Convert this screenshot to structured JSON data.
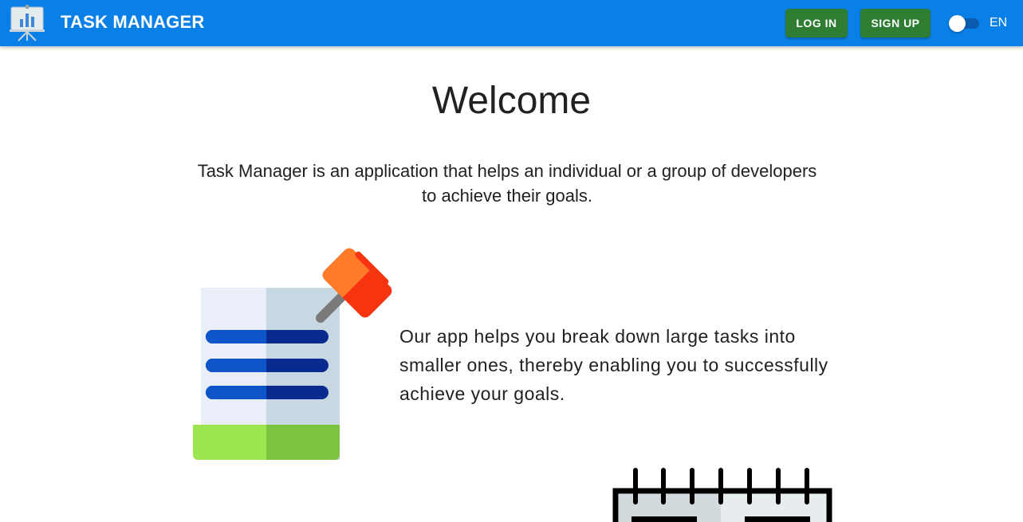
{
  "header": {
    "title": "TASK MANAGER",
    "logo_icon": "presentation-board-chart-icon",
    "login_label": "LOG IN",
    "signup_label": "SIGN UP",
    "language_toggle": {
      "checked": false,
      "label": "EN"
    }
  },
  "main": {
    "heading": "Welcome",
    "intro": "Task Manager is an application that helps an individual or a group of developers to achieve their goals.",
    "features": [
      {
        "icon": "pinned-task-list-icon",
        "text": "Our app helps you break down large tasks into smaller ones, thereby enabling you to successfully achieve your goals."
      },
      {
        "icon": "calendar-icon",
        "text": ""
      }
    ]
  },
  "colors": {
    "appbar": "#0880e8",
    "button": "#2e7d32",
    "text": "#212121"
  }
}
